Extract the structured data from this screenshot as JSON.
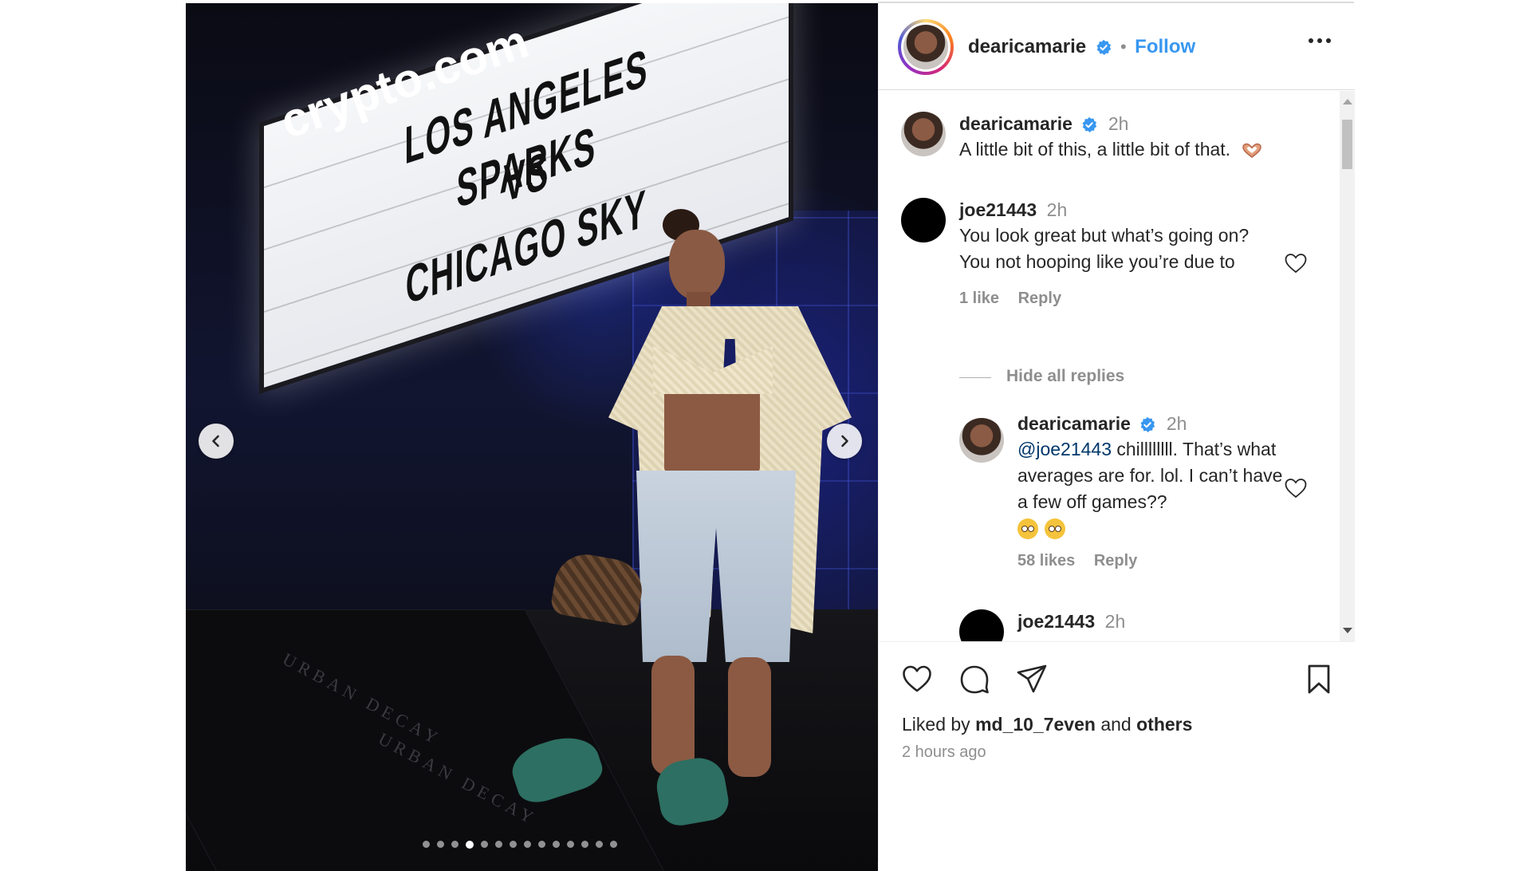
{
  "photo": {
    "brand_text": "crypto.com",
    "marquee_lines": [
      "LOS ANGELES SPARKS",
      "VS",
      "CHICAGO SKY"
    ],
    "mat_text": "URBAN DECAY",
    "carousel": {
      "total": 14,
      "active_index": 3
    },
    "prev_icon": "chevron-left-icon",
    "next_icon": "chevron-right-icon"
  },
  "header": {
    "username": "dearicamarie",
    "separator": "•",
    "follow_label": "Follow",
    "more_icon": "more-horizontal-icon"
  },
  "comments": {
    "caption": {
      "username": "dearicamarie",
      "time": "2h",
      "text": "A little bit of this, a little bit of that."
    },
    "items": [
      {
        "username": "joe21443",
        "time": "2h",
        "text": "You look great but what’s going on? You not hooping like you’re due to",
        "likes": "1 like",
        "reply_label": "Reply"
      }
    ],
    "hide_replies_label": "Hide all replies",
    "reply": {
      "username": "dearicamarie",
      "time": "2h",
      "mention": "@joe21443",
      "text": " chillllllll. That’s what averages are for. lol. I can’t have a few off games??",
      "likes": "58 likes",
      "reply_label": "Reply"
    },
    "next_reply": {
      "username": "joe21443",
      "time": "2h"
    }
  },
  "actions": {
    "liked_by_prefix": "Liked by ",
    "liked_by_user": "md_10_7even",
    "liked_by_and": " and ",
    "liked_by_others": "others",
    "time_ago": "2 hours ago"
  },
  "colors": {
    "follow": "#3897f0",
    "verified": "#3897f0",
    "secondary_text": "#8e8e8e"
  }
}
